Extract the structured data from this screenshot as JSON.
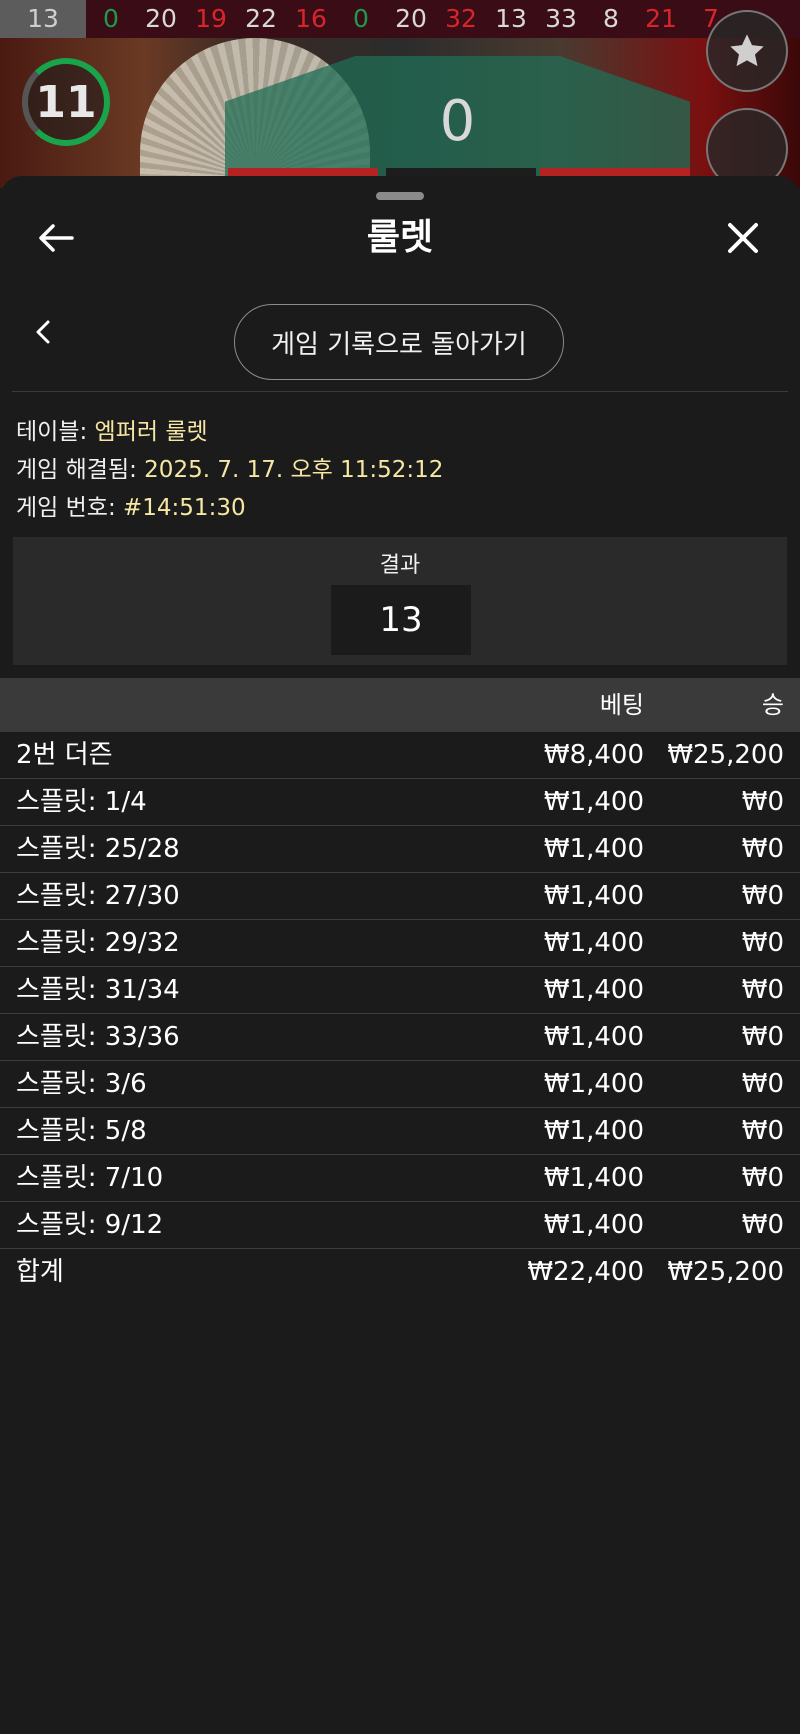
{
  "history": [
    {
      "n": "13",
      "c": "black"
    },
    {
      "n": "0",
      "c": "green"
    },
    {
      "n": "20",
      "c": "black"
    },
    {
      "n": "19",
      "c": "red"
    },
    {
      "n": "22",
      "c": "black"
    },
    {
      "n": "16",
      "c": "red"
    },
    {
      "n": "0",
      "c": "green"
    },
    {
      "n": "20",
      "c": "black"
    },
    {
      "n": "32",
      "c": "red"
    },
    {
      "n": "13",
      "c": "black"
    },
    {
      "n": "33",
      "c": "black"
    },
    {
      "n": "8",
      "c": "black"
    },
    {
      "n": "21",
      "c": "red"
    },
    {
      "n": "7",
      "c": "red"
    }
  ],
  "game": {
    "timer": "11",
    "board_value": "0"
  },
  "sheet": {
    "title": "룰렛",
    "back_to_history": "게임 기록으로 돌아가기",
    "info": {
      "table_label": "테이블: ",
      "table_value": "엠퍼러 룰렛",
      "resolved_label": "게임 해결됨: ",
      "resolved_value": "2025. 7. 17. 오후 11:52:12",
      "game_no_label": "게임 번호: ",
      "game_no_value": "#14:51:30"
    },
    "result": {
      "label": "결과",
      "value": "13"
    }
  },
  "table": {
    "headers": {
      "bet": "베팅",
      "win": "승"
    },
    "rows": [
      {
        "name": "2번 더즌",
        "bet": "₩8,400",
        "win": "₩25,200"
      },
      {
        "name": "스플릿: 1/4",
        "bet": "₩1,400",
        "win": "₩0"
      },
      {
        "name": "스플릿: 25/28",
        "bet": "₩1,400",
        "win": "₩0"
      },
      {
        "name": "스플릿: 27/30",
        "bet": "₩1,400",
        "win": "₩0"
      },
      {
        "name": "스플릿: 29/32",
        "bet": "₩1,400",
        "win": "₩0"
      },
      {
        "name": "스플릿: 31/34",
        "bet": "₩1,400",
        "win": "₩0"
      },
      {
        "name": "스플릿: 33/36",
        "bet": "₩1,400",
        "win": "₩0"
      },
      {
        "name": "스플릿: 3/6",
        "bet": "₩1,400",
        "win": "₩0"
      },
      {
        "name": "스플릿: 5/8",
        "bet": "₩1,400",
        "win": "₩0"
      },
      {
        "name": "스플릿: 7/10",
        "bet": "₩1,400",
        "win": "₩0"
      },
      {
        "name": "스플릿: 9/12",
        "bet": "₩1,400",
        "win": "₩0"
      }
    ],
    "total": {
      "name": "합계",
      "bet": "₩22,400",
      "win": "₩25,200"
    }
  },
  "icons": {
    "back": "arrow-left-icon",
    "close": "close-icon",
    "prev": "chevron-left-icon",
    "favorite": "star-icon",
    "more": "more-icon"
  }
}
